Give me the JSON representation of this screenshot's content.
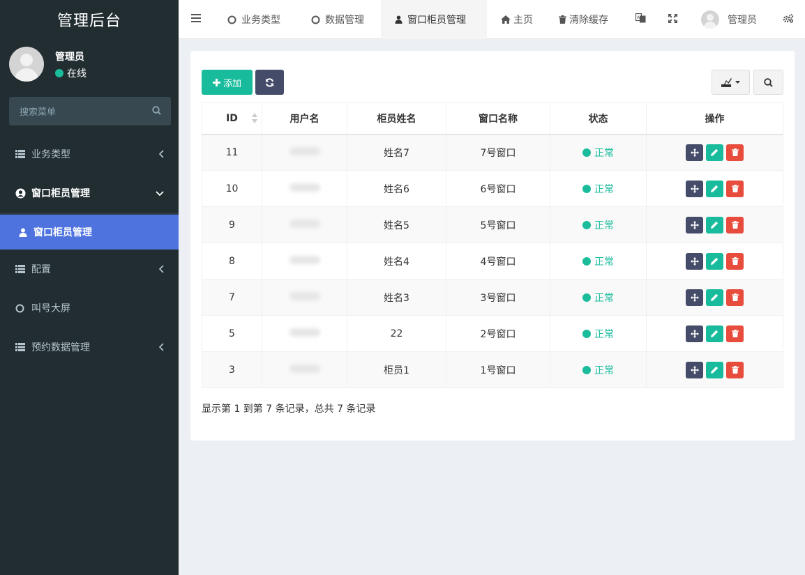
{
  "sidebar": {
    "brand": "管理后台",
    "user": {
      "name": "管理员",
      "status": "在线"
    },
    "search_placeholder": "搜索菜单",
    "menu": [
      {
        "label": "业务类型",
        "icon": "list-icon"
      },
      {
        "label": "窗口柜员管理",
        "icon": "user-circle-icon"
      },
      {
        "label": "窗口柜员管理",
        "icon": "user-icon"
      },
      {
        "label": "配置",
        "icon": "list-icon"
      },
      {
        "label": "叫号大屏",
        "icon": "circle-icon"
      },
      {
        "label": "预约数据管理",
        "icon": "list-icon"
      }
    ]
  },
  "topbar": {
    "tabs": [
      {
        "label": "业务类型"
      },
      {
        "label": "数据管理"
      },
      {
        "label": "窗口柜员管理"
      }
    ],
    "home": "主页",
    "clear_cache": "清除缓存",
    "user": "管理员"
  },
  "toolbar": {
    "add": "添加"
  },
  "table": {
    "headers": [
      "ID",
      "用户名",
      "柜员姓名",
      "窗口名称",
      "状态",
      "操作"
    ],
    "rows": [
      {
        "id": "11",
        "name": "姓名7",
        "window": "7号窗口",
        "status": "正常"
      },
      {
        "id": "10",
        "name": "姓名6",
        "window": "6号窗口",
        "status": "正常"
      },
      {
        "id": "9",
        "name": "姓名5",
        "window": "5号窗口",
        "status": "正常"
      },
      {
        "id": "8",
        "name": "姓名4",
        "window": "4号窗口",
        "status": "正常"
      },
      {
        "id": "7",
        "name": "姓名3",
        "window": "3号窗口",
        "status": "正常"
      },
      {
        "id": "5",
        "name": "22",
        "window": "2号窗口",
        "status": "正常"
      },
      {
        "id": "3",
        "name": "柜员1",
        "window": "1号窗口",
        "status": "正常"
      }
    ]
  },
  "pagination_text": "显示第 1 到第 7 条记录，总共 7 条记录",
  "colors": {
    "sidebar_bg": "#222d32",
    "active_blue": "#4e73df",
    "success": "#18bc9c",
    "dark": "#444c69",
    "danger": "#e74c3c"
  }
}
